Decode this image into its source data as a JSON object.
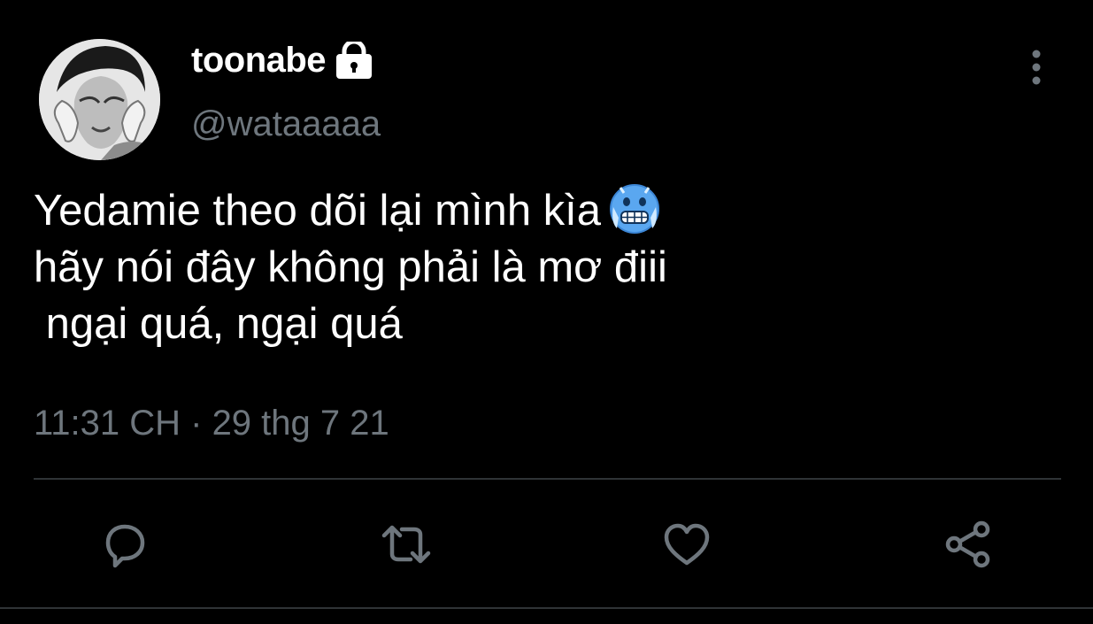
{
  "author": {
    "display_name": "toonabe",
    "handle": "@wataaaaa",
    "protected_icon": "lock-icon",
    "avatar": "profile-photo"
  },
  "tweet": {
    "lines": [
      "Yedamie theo dõi lại mình kìa",
      "hãy nói đây không phải là mơ điii",
      " ngại quá, ngại quá"
    ],
    "emoji": "cold-face-emoji",
    "timestamp": "11:31 CH · 29 thg 7 21"
  },
  "actions": {
    "reply": "reply-icon",
    "retweet": "retweet-icon",
    "like": "heart-icon",
    "share": "share-icon",
    "more": "more-vertical-icon"
  },
  "colors": {
    "background": "#000000",
    "text": "#ffffff",
    "secondary": "#6e767d",
    "divider": "#2f3336"
  }
}
